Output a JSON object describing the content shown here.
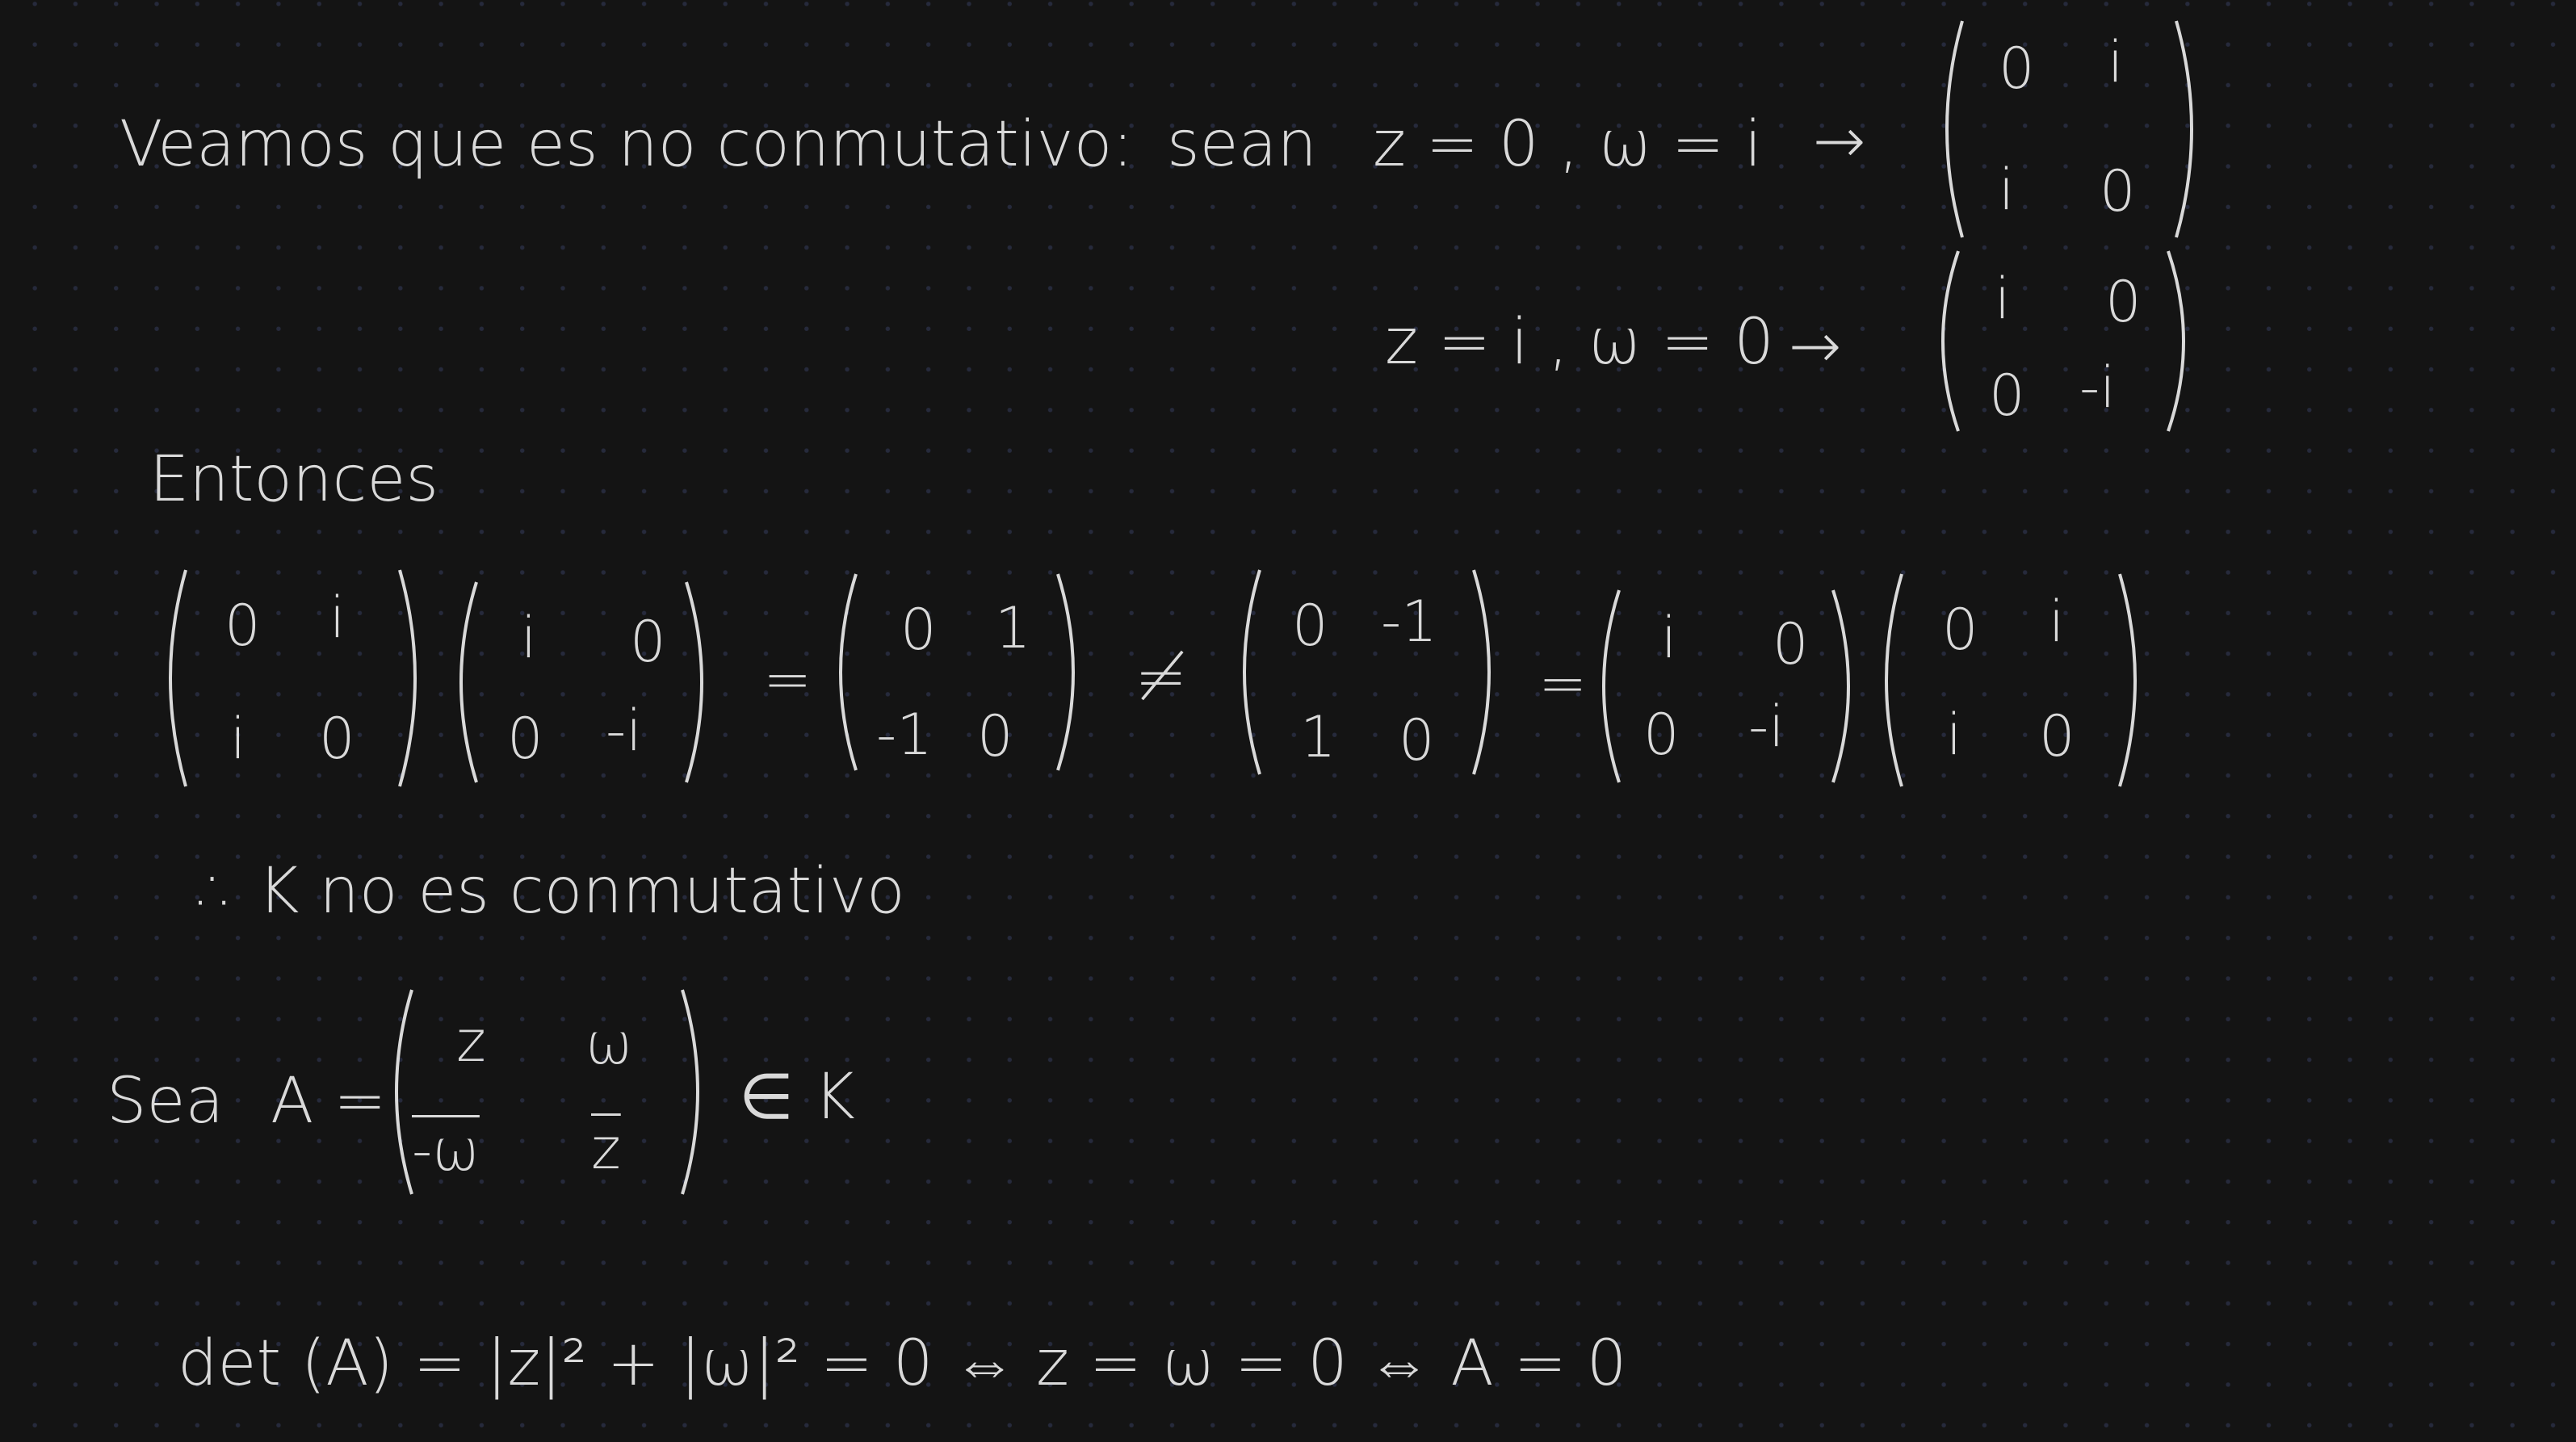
{
  "line1": {
    "text": "Veamos que es no conmutativo:",
    "sean": "sean",
    "assign": "z = 0 , ω = i",
    "arrow": "→",
    "matrix": {
      "a": "0",
      "b": "i",
      "c": "i",
      "d": "0"
    }
  },
  "line2": {
    "assign": "z = i , ω = 0",
    "arrow": "→",
    "matrix": {
      "a": "i",
      "b": "0",
      "c": "0",
      "d": "-i"
    }
  },
  "entonces": "Entonces",
  "product": {
    "m1": {
      "a": "0",
      "b": "i",
      "c": "i",
      "d": "0"
    },
    "m2": {
      "a": "i",
      "b": "0",
      "c": "0",
      "d": "-i"
    },
    "eq1": "=",
    "m3": {
      "a": "0",
      "b": "1",
      "c": "-1",
      "d": "0"
    },
    "neq": "≠",
    "m4": {
      "a": "0",
      "b": "-1",
      "c": "1",
      "d": "0"
    },
    "eq2": "=",
    "m5": {
      "a": "i",
      "b": "0",
      "c": "0",
      "d": "-i"
    },
    "m6": {
      "a": "0",
      "b": "i",
      "c": "i",
      "d": "0"
    }
  },
  "conclusion": "∴ K no es conmutativo",
  "sea": {
    "prefix": "Sea",
    "label": "A =",
    "matrix": {
      "a": "z",
      "b": "ω",
      "c": "-ω",
      "d": "z"
    },
    "suffix": "∈ K"
  },
  "det_line": "det (A) = |z|² + |ω|² = 0 ⇔ z = ω = 0 ⇔ A = 0"
}
